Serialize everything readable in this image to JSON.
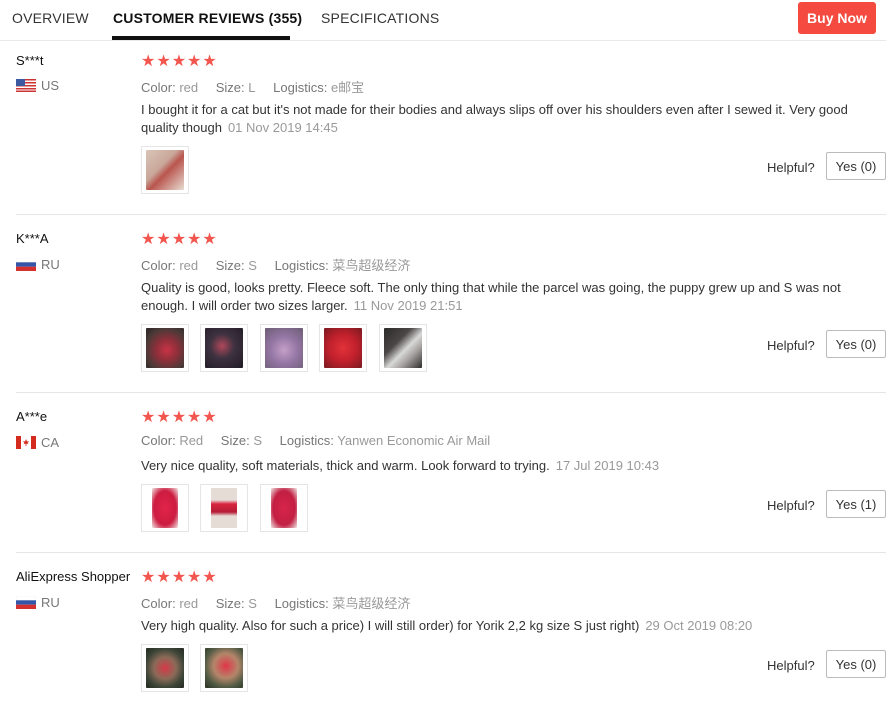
{
  "tabs": [
    {
      "label": "OVERVIEW"
    },
    {
      "label": "CUSTOMER REVIEWS (355)"
    },
    {
      "label": "SPECIFICATIONS"
    }
  ],
  "buy_now_label": "Buy Now",
  "colors": {
    "accent": "#f44a3f",
    "star": "#f2564e"
  },
  "stars_text": "★★★★★",
  "labels": {
    "color": "Color:",
    "size": "Size:",
    "logistics": "Logistics:",
    "helpful": "Helpful?"
  },
  "reviews": [
    {
      "name": "S***t",
      "country": "US",
      "flag": "us-flag-icon",
      "rating": 5,
      "color": "red",
      "size": "L",
      "logistics": "e邮宝",
      "text": "I bought it for a cat but it's not made for their bodies and always slips off over his shoulders even after I sewed it. Very good quality though",
      "date": "01 Nov 2019 14:45",
      "helpful_label": "Yes (0)"
    },
    {
      "name": "K***A",
      "country": "RU",
      "flag": "ru-flag-icon",
      "rating": 5,
      "color": "red",
      "size": "S",
      "logistics": "菜鸟超级经济",
      "text": "Quality is good, looks pretty. Fleece soft. The only thing that while the parcel was going, the puppy grew up and S was not enough. I will order two sizes larger.",
      "date": "11 Nov 2019 21:51",
      "helpful_label": "Yes (0)"
    },
    {
      "name": "A***e",
      "country": "CA",
      "flag": "ca-flag-icon",
      "rating": 5,
      "color": "Red",
      "size": "S",
      "logistics": "Yanwen Economic Air Mail",
      "text": "Very nice quality, soft materials, thick and warm. Look forward to trying.",
      "date": "17 Jul 2019 10:43",
      "helpful_label": "Yes (1)"
    },
    {
      "name": "AliExpress Shopper",
      "country": "RU",
      "flag": "ru-flag-icon",
      "rating": 5,
      "color": "red",
      "size": "S",
      "logistics": "菜鸟超级经济",
      "text": "Very high quality. Also for such a price) I will still order) for Yorik 2,2 kg size S just right)",
      "date": "29 Oct 2019 08:20",
      "helpful_label": "Yes (0)"
    }
  ]
}
